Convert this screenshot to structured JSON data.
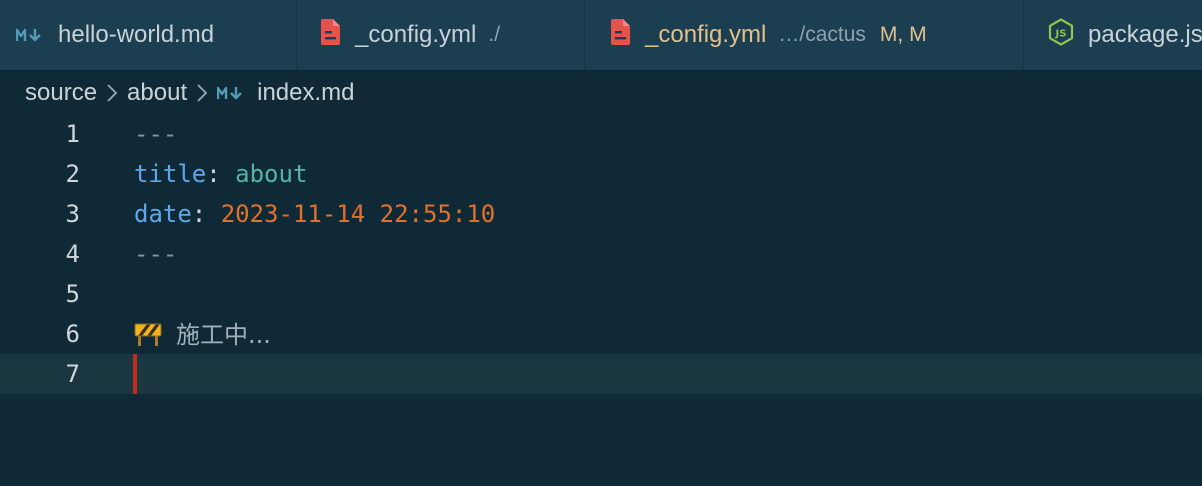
{
  "tabs": [
    {
      "icon": "markdown-icon",
      "label": "hello-world.md",
      "description": "",
      "modified": ""
    },
    {
      "icon": "yaml-file-icon",
      "label": "_config.yml",
      "description": "./",
      "modified": ""
    },
    {
      "icon": "yaml-file-icon",
      "label": "_config.yml",
      "description": "…/cactus",
      "modified": "M, M"
    },
    {
      "icon": "nodejs-icon",
      "label": "package.json",
      "description": "",
      "modified": ""
    }
  ],
  "breadcrumb": {
    "items": [
      "source",
      "about",
      "index.md"
    ],
    "file_icon": "markdown-icon"
  },
  "editor": {
    "line_numbers": [
      "1",
      "2",
      "3",
      "4",
      "5",
      "6",
      "7"
    ],
    "lines": {
      "l1": "---",
      "l2_key": "title",
      "l2_colon": ":",
      "l2_value": "about",
      "l3_key": "date",
      "l3_colon": ":",
      "l3_value": "2023-11-14 22:55:10",
      "l4": "---",
      "l6_icon": "construction-icon",
      "l6_text": "施工中..."
    },
    "current_line": 7
  },
  "colors": {
    "background": "#0f2a36",
    "tabbar": "#1b3e50",
    "key": "#5fa8e8",
    "string": "#56b3a3",
    "number": "#e0702c",
    "modified": "#e2c08d",
    "cursor": "#c42b1c",
    "markdown_icon": "#519aba",
    "yaml_icon": "#e5534b",
    "nodejs_icon": "#8cc84b"
  }
}
